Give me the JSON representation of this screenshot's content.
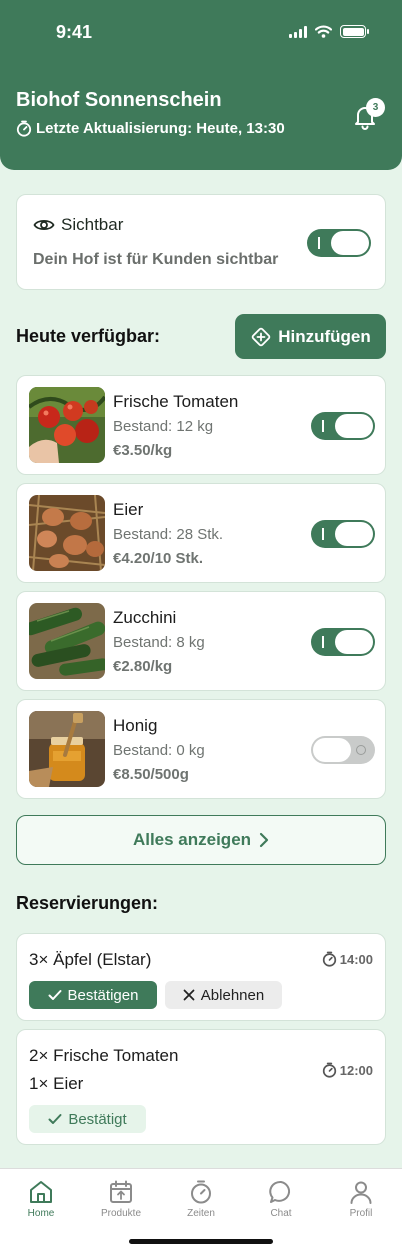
{
  "status_bar": {
    "time": "9:41"
  },
  "header": {
    "title": "Biohof Sonnenschein",
    "last_update": "Letzte Aktualisierung: Heute, 13:30",
    "notification_count": "3",
    "accent_color": "#3f7a5a"
  },
  "visibility": {
    "label": "Sichtbar",
    "description": "Dein Hof ist für Kunden sichtbar",
    "enabled": true
  },
  "available": {
    "title": "Heute verfügbar:",
    "add_label": "Hinzufügen",
    "products": [
      {
        "name": "Frische Tomaten",
        "stock": "Bestand: 12 kg",
        "price": "€3.50/kg",
        "enabled": true
      },
      {
        "name": "Eier",
        "stock": "Bestand: 28 Stk.",
        "price": "€4.20/10 Stk.",
        "enabled": true
      },
      {
        "name": "Zucchini",
        "stock": "Bestand: 8 kg",
        "price": "€2.80/kg",
        "enabled": true
      },
      {
        "name": "Honig",
        "stock": "Bestand: 0 kg",
        "price": "€8.50/500g",
        "enabled": false
      }
    ],
    "show_all_label": "Alles anzeigen"
  },
  "reservations": {
    "title": "Reservierungen:",
    "items": [
      {
        "lines": [
          "3× Äpfel (Elstar)"
        ],
        "time": "14:00",
        "confirm_label": "Bestätigen",
        "reject_label": "Ablehnen"
      },
      {
        "lines": [
          "2× Frische Tomaten",
          "1× Eier"
        ],
        "time": "12:00",
        "status_label": "Bestätigt"
      }
    ]
  },
  "tabs": [
    {
      "label": "Home",
      "icon": "home-icon",
      "active": true
    },
    {
      "label": "Produkte",
      "icon": "calendar-upload-icon",
      "active": false
    },
    {
      "label": "Zeiten",
      "icon": "stopwatch-icon",
      "active": false
    },
    {
      "label": "Chat",
      "icon": "chat-bubble-icon",
      "active": false
    },
    {
      "label": "Profil",
      "icon": "person-icon",
      "active": false
    }
  ]
}
